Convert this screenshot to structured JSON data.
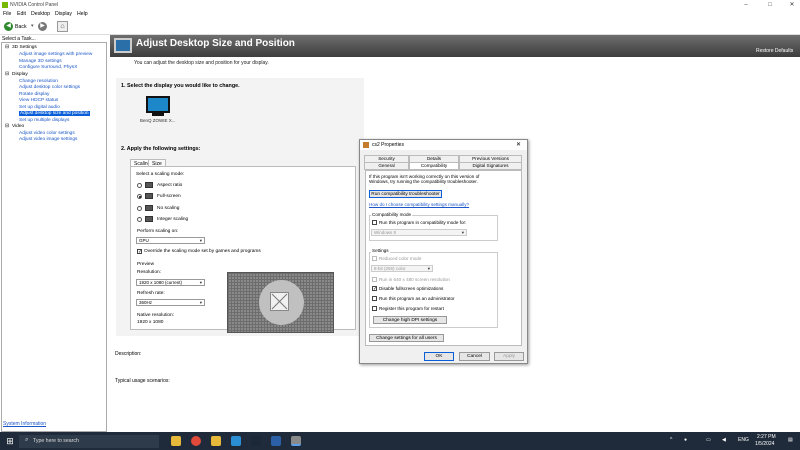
{
  "window": {
    "title": "NVIDIA Control Panel"
  },
  "menu": [
    "File",
    "Edit",
    "Desktop",
    "Display",
    "Help"
  ],
  "toolbar": {
    "back_label": "Back"
  },
  "sidebar": {
    "task_label": "Select a Task...",
    "items": [
      {
        "label": "3D Settings",
        "level": 0
      },
      {
        "label": "Adjust image settings with preview",
        "level": 1
      },
      {
        "label": "Manage 3D settings",
        "level": 1
      },
      {
        "label": "Configure Surround, PhysX",
        "level": 1
      },
      {
        "label": "Display",
        "level": 0
      },
      {
        "label": "Change resolution",
        "level": 1
      },
      {
        "label": "Adjust desktop color settings",
        "level": 1
      },
      {
        "label": "Rotate display",
        "level": 1
      },
      {
        "label": "View HDCP status",
        "level": 1
      },
      {
        "label": "Set up digital audio",
        "level": 1
      },
      {
        "label": "Adjust desktop size and position",
        "level": 1,
        "selected": true
      },
      {
        "label": "Set up multiple displays",
        "level": 1
      },
      {
        "label": "Video",
        "level": 0
      },
      {
        "label": "Adjust video color settings",
        "level": 1
      },
      {
        "label": "Adjust video image settings",
        "level": 1
      }
    ],
    "system_info": "System Information"
  },
  "main": {
    "title": "Adjust Desktop Size and Position",
    "restore_defaults": "Restore Defaults",
    "intro": "You can adjust the desktop size and position for your display.",
    "step1": "1. Select the display you would like to change.",
    "monitor_label": "BenQ ZOWIE X...",
    "step2": "2. Apply the following settings:",
    "tabs": [
      "Scaling",
      "Size"
    ],
    "scaling_mode_label": "Select a scaling mode:",
    "scaling_modes": [
      "Aspect ratio",
      "Full-screen",
      "No scaling",
      "Integer scaling"
    ],
    "selected_mode": "Full-screen",
    "perform_label": "Perform scaling on:",
    "perform_value": "GPU",
    "override_label": "Override the scaling mode set by games and programs",
    "preview_label": "Preview",
    "resolution_label": "Resolution:",
    "resolution_value": "1920 x 1080 (current)",
    "refresh_label": "Refresh rate:",
    "refresh_value": "360Hz",
    "native_label": "Native resolution:",
    "native_value": "1920 x 1080",
    "description_label": "Description:",
    "usage_label": "Typical usage scenarios:"
  },
  "dialog": {
    "title": "cs2 Properties",
    "tabs_row1": [
      "Security",
      "Details",
      "Previous Versions"
    ],
    "tabs_row2": [
      "General",
      "Compatibility",
      "Digital Signatures"
    ],
    "intro": "If this program isn't working correctly on this version of Windows, try running the compatibility troubleshooter.",
    "troubleshooter_button": "Run compatibility troubleshooter",
    "manual_link": "How do I choose compatibility settings manually?",
    "compat_mode_group": "Compatibility mode",
    "compat_mode_cb": "Run this program in compatibility mode for:",
    "compat_os": "Windows 8",
    "settings_group": "Settings",
    "reduced_color": "Reduced color mode",
    "color_value": "8-bit (256) color",
    "run_640": "Run in 640 x 480 screen resolution",
    "disable_fullscreen": "Disable fullscreen optimizations",
    "run_admin": "Run this program as an administrator",
    "register_restart": "Register this program for restart",
    "dpi_button": "Change high DPI settings",
    "all_users_button": "Change settings for all users",
    "ok": "OK",
    "cancel": "Cancel",
    "apply": "Apply"
  },
  "taskbar": {
    "search_placeholder": "Type here to search",
    "time": "2:27 PM",
    "date": "1/5/2024",
    "lang": "ENG"
  },
  "colors": {
    "nvidia_green": "#76b900",
    "selection_blue": "#0a5fd8",
    "taskbar": "#1f2b3a"
  }
}
